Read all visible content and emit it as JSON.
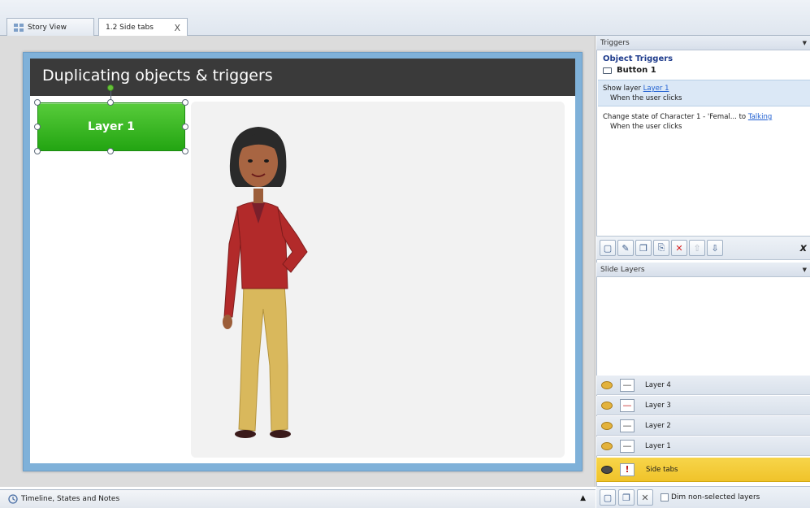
{
  "tabs": {
    "story_view": "Story View",
    "slide": "1.2 Side tabs",
    "close": "X"
  },
  "slide": {
    "title": "Duplicating objects & triggers",
    "button_label": "Layer 1"
  },
  "bottom_bar": {
    "label": "Timeline, States and Notes",
    "caret": "▲"
  },
  "triggers_panel": {
    "header": "Triggers",
    "section_title": "Object Triggers",
    "object_name": "Button 1",
    "items": [
      {
        "action": "Show layer",
        "target": "Layer 1",
        "condition": "When the user clicks"
      },
      {
        "action": "Change state of Character 1 - 'Femal... to",
        "target": "Talking",
        "condition": "When the user clicks"
      }
    ],
    "toolbar_x": "x"
  },
  "layers_panel": {
    "header": "Slide Layers",
    "layers": [
      "Layer 4",
      "Layer 3",
      "Layer 2",
      "Layer 1"
    ],
    "base_layer": "Side tabs",
    "dim_label": "Dim non-selected layers"
  },
  "colors": {
    "slide_frame": "#7fb1d9",
    "title_bar": "#3a3a3a",
    "button_green": "#23a512",
    "base_layer_yellow": "#f0c32a",
    "link_blue": "#1f5fd1"
  }
}
